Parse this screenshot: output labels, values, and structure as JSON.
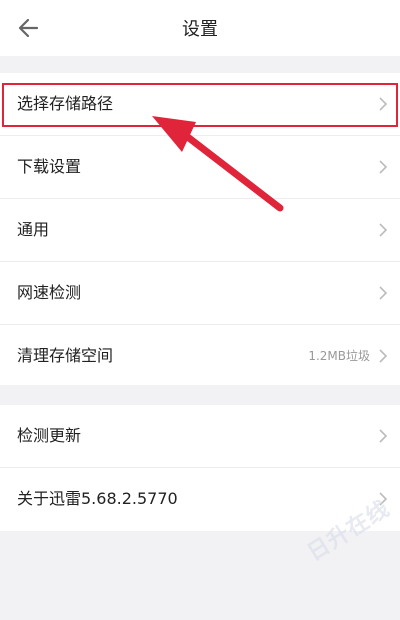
{
  "header": {
    "title": "设置",
    "back_icon": "back-arrow-icon"
  },
  "settings_group_1": [
    {
      "label": "选择存储路径",
      "value": ""
    },
    {
      "label": "下载设置",
      "value": ""
    },
    {
      "label": "通用",
      "value": ""
    },
    {
      "label": "网速检测",
      "value": ""
    },
    {
      "label": "清理存储空间",
      "value": "1.2MB垃圾"
    }
  ],
  "settings_group_2": [
    {
      "label": "检测更新",
      "value": ""
    },
    {
      "label": "关于迅雷5.68.2.5770",
      "value": ""
    }
  ],
  "annotation": {
    "highlight_color": "#e0243a",
    "arrow_color": "#e0243a"
  },
  "watermark": "日升在线"
}
